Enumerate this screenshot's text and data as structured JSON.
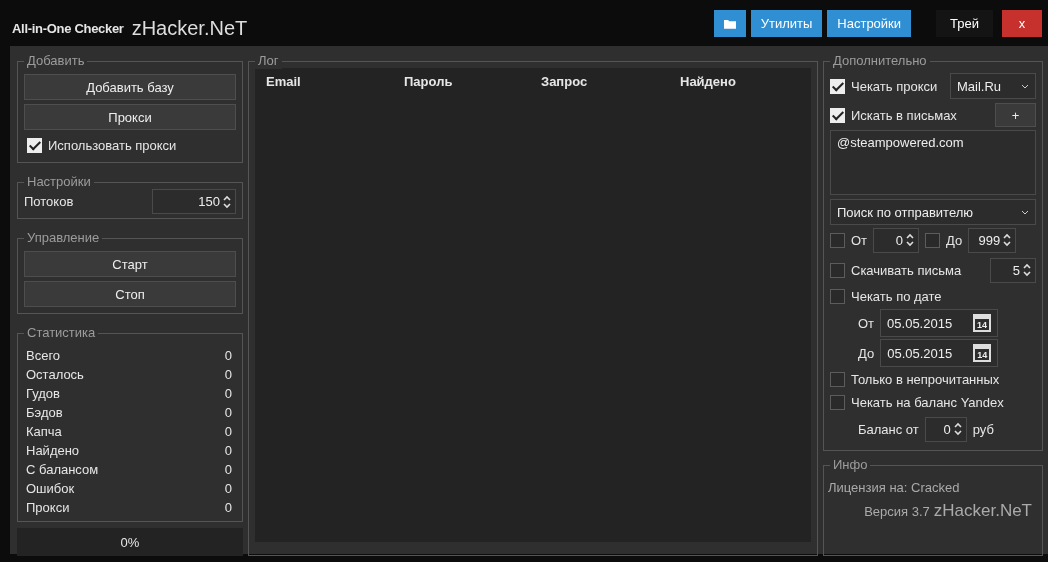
{
  "window": {
    "title": "All-in-One Checker",
    "brand": "zHacker.NeT"
  },
  "toolbar": [
    {
      "kind": "folder"
    },
    {
      "kind": "blue",
      "label": "Утилиты"
    },
    {
      "kind": "blue",
      "label": "Настройки"
    },
    {
      "kind": "plain",
      "label": "Трей"
    },
    {
      "kind": "close",
      "label": "x"
    }
  ],
  "add": {
    "title": "Добавить",
    "buttons": [
      "Добавить базу",
      "Прокси"
    ],
    "use_proxy": {
      "label": "Использовать прокси",
      "checked": true
    }
  },
  "settings": {
    "title": "Настройки",
    "threads": {
      "label": "Потоков",
      "value": "150"
    }
  },
  "control": {
    "title": "Управление",
    "buttons": [
      "Старт",
      "Стоп"
    ]
  },
  "stats": {
    "title": "Статистика",
    "rows": [
      {
        "label": "Всего",
        "value": "0"
      },
      {
        "label": "Осталось",
        "value": "0"
      },
      {
        "label": "Гудов",
        "value": "0"
      },
      {
        "label": "Бэдов",
        "value": "0"
      },
      {
        "label": "Капча",
        "value": "0"
      },
      {
        "label": "Найдено",
        "value": "0"
      },
      {
        "label": "С балансом",
        "value": "0"
      },
      {
        "label": "Ошибок",
        "value": "0"
      },
      {
        "label": "Прокси",
        "value": "0"
      }
    ]
  },
  "progress": {
    "label": "0%",
    "level": 0
  },
  "log": {
    "title": "Лог",
    "columns": [
      "Email",
      "Пароль",
      "Запрос",
      "Найдено"
    ]
  },
  "extra": {
    "title": "Дополнительно",
    "check_proxy": {
      "label": "Чекать прокси",
      "checked": true,
      "dropdown": "Mail.Ru"
    },
    "search_in_mail": {
      "label": "Искать в письмах",
      "checked": true,
      "button": "+"
    },
    "query": "@steampowered.com",
    "search_mode": "Поиск по отправителю",
    "range": [
      {
        "label": "От",
        "checked": false,
        "value": "0"
      },
      {
        "label": "До",
        "checked": false,
        "value": "999"
      }
    ],
    "download": {
      "label": "Скачивать письма",
      "checked": false,
      "value": "5"
    },
    "by_date": {
      "label": "Чекать по дате",
      "checked": false
    },
    "dates": [
      {
        "label": "От",
        "value": "05.05.2015",
        "icon_text": "14"
      },
      {
        "label": "До",
        "value": "05.05.2015",
        "icon_text": "14"
      }
    ],
    "unread": {
      "label": "Только в непрочитанных",
      "checked": false
    },
    "yandex": {
      "label": "Чекать на баланс Yandex",
      "checked": false
    },
    "balance": {
      "label": "Баланс от",
      "value": "0",
      "unit": "руб"
    }
  },
  "info": {
    "title": "Инфо",
    "license": "Лицензия на: Cracked",
    "version": "Версия 3.7",
    "brand": "zHacker.NeT"
  }
}
